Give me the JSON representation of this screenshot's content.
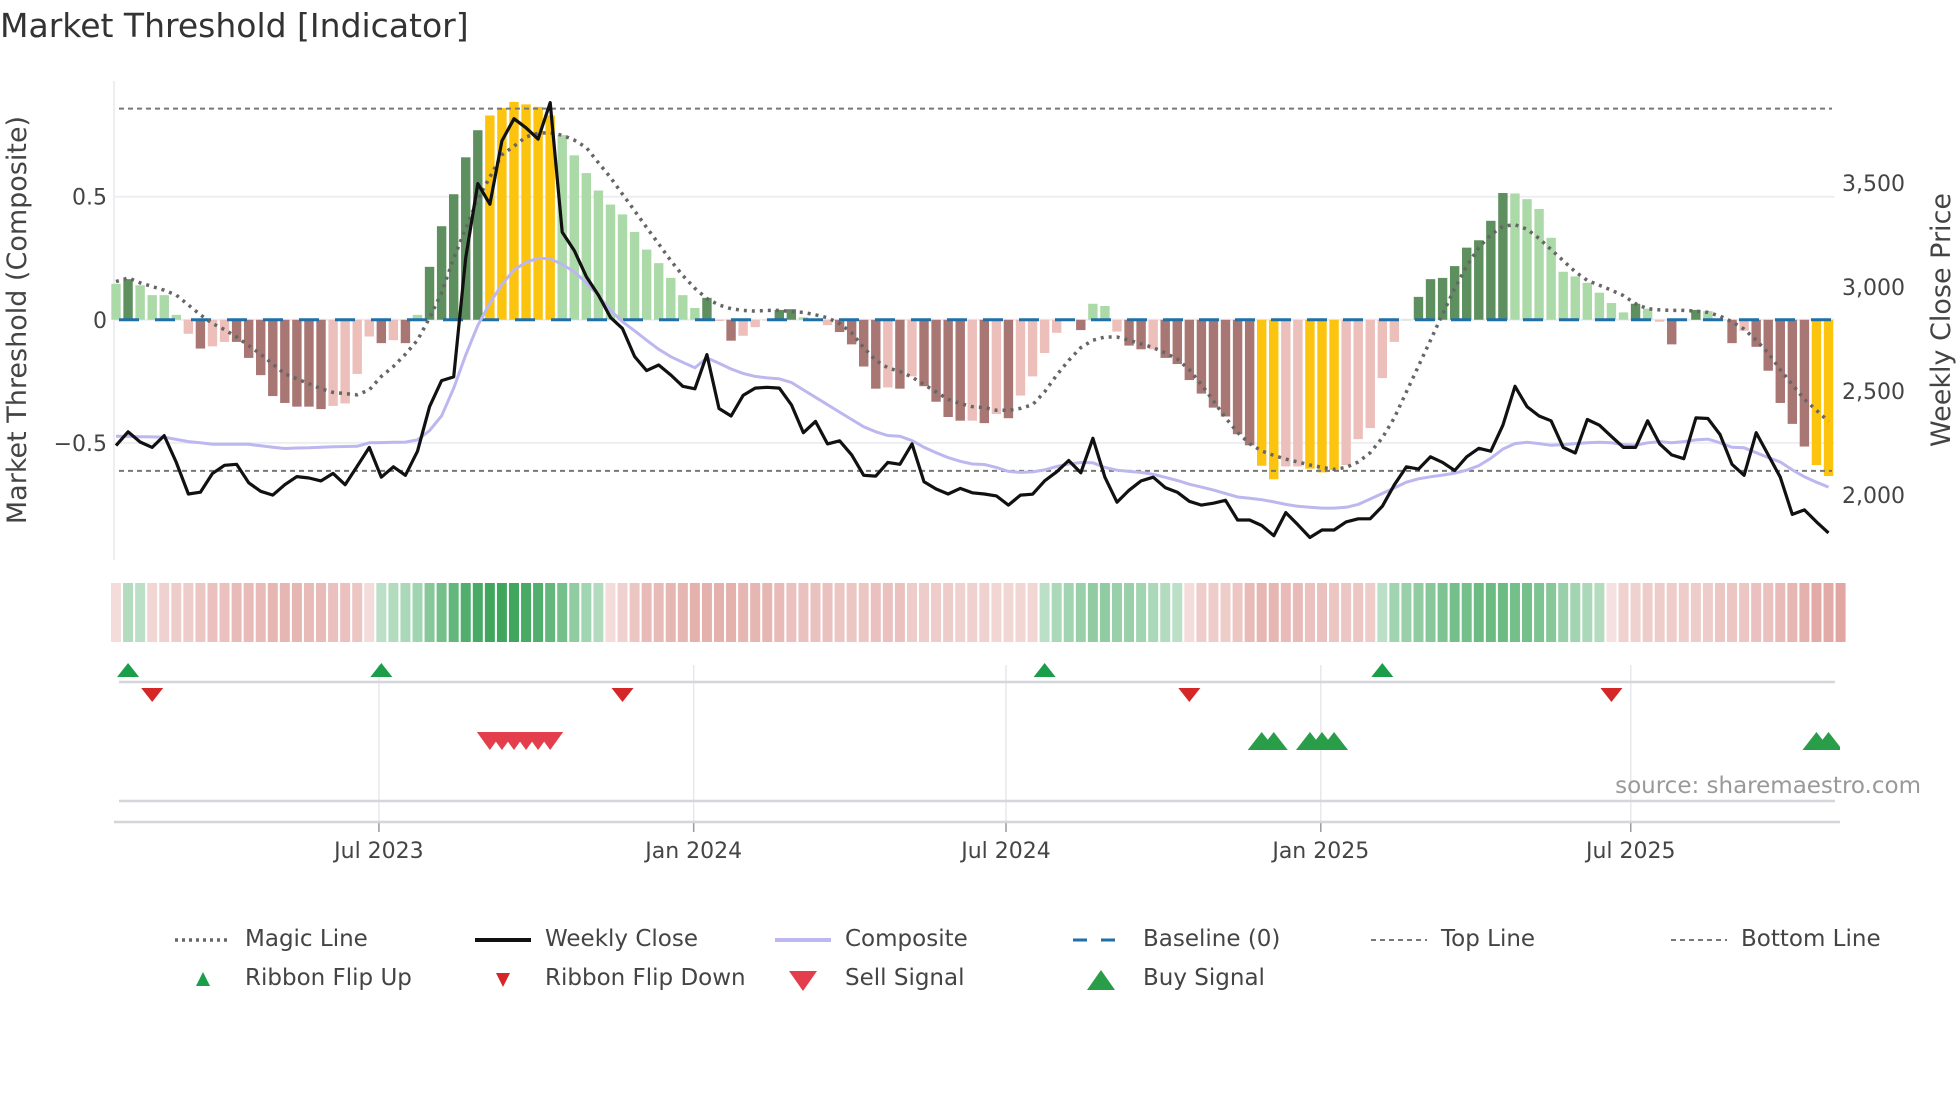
{
  "title": "Market Threshold [Indicator]",
  "source": "source: sharemaestro.com",
  "chart_data": {
    "type": "bar",
    "title": "Market Threshold [Indicator]",
    "ylabel_left": "Market Threshold (Composite)",
    "ylabel_right": "Weekly Close Price",
    "ylim_left": [
      -0.976,
      0.97
    ],
    "ylim_right": [
      1688,
      3990
    ],
    "left_ticks": [
      {
        "v": 0.5,
        "label": "0.5"
      },
      {
        "v": 0,
        "label": "0"
      },
      {
        "v": -0.5,
        "label": "−0.5"
      }
    ],
    "right_ticks": [
      {
        "v": 3500,
        "label": "3,500"
      },
      {
        "v": 3000,
        "label": "3,000"
      },
      {
        "v": 2500,
        "label": "2,500"
      },
      {
        "v": 2000,
        "label": "2,000"
      }
    ],
    "x_ticks": [
      {
        "week": 21.8,
        "label": "Jul 2023"
      },
      {
        "week": 47.9,
        "label": "Jan 2024"
      },
      {
        "week": 73.8,
        "label": "Jul 2024"
      },
      {
        "week": 99.9,
        "label": "Jan 2025"
      },
      {
        "week": 125.6,
        "label": "Jul 2025"
      }
    ],
    "top_line": 0.858,
    "bottom_line": -0.614,
    "baseline": 0,
    "colors": {
      "G": "#5e8f5e",
      "g": "#acd9a8",
      "R": "#a87673",
      "r": "#ecbfbb",
      "Y": "#fcc30f",
      "magic": "#666666",
      "close": "#111111",
      "composite": "#bcb7ef",
      "baseline": "#1f6fa8",
      "ref": "#777777",
      "flip_up": "#1a9e4a",
      "flip_down": "#d62728",
      "sell": "#e43d4b",
      "buy": "#2a9d48",
      "ribbon_pos": "#2e9e4f",
      "ribbon_neg": "#d4807a"
    },
    "composite_bars": [
      0.146,
      0.165,
      0.14,
      0.1,
      0.1,
      0.02,
      -0.057,
      -0.117,
      -0.108,
      -0.09,
      -0.09,
      -0.155,
      -0.225,
      -0.31,
      -0.338,
      -0.353,
      -0.353,
      -0.363,
      -0.35,
      -0.34,
      -0.22,
      -0.068,
      -0.095,
      -0.083,
      -0.095,
      0.02,
      0.215,
      0.38,
      0.51,
      0.66,
      0.77,
      0.83,
      0.86,
      0.885,
      0.875,
      0.865,
      0.83,
      0.75,
      0.668,
      0.596,
      0.525,
      0.468,
      0.428,
      0.357,
      0.285,
      0.23,
      0.17,
      0.1,
      0.048,
      0.089,
      -0.005,
      -0.085,
      -0.065,
      -0.03,
      0,
      0.04,
      0.043,
      0.01,
      0.005,
      -0.022,
      -0.05,
      -0.1,
      -0.19,
      -0.28,
      -0.275,
      -0.28,
      -0.23,
      -0.27,
      -0.333,
      -0.395,
      -0.41,
      -0.41,
      -0.42,
      -0.383,
      -0.4,
      -0.308,
      -0.23,
      -0.135,
      -0.053,
      0,
      -0.042,
      0.065,
      0.056,
      -0.048,
      -0.105,
      -0.12,
      -0.12,
      -0.155,
      -0.18,
      -0.245,
      -0.3,
      -0.357,
      -0.393,
      -0.465,
      -0.51,
      -0.593,
      -0.648,
      -0.596,
      -0.596,
      -0.605,
      -0.62,
      -0.61,
      -0.59,
      -0.485,
      -0.44,
      -0.237,
      -0.09,
      0,
      0.093,
      0.165,
      0.17,
      0.218,
      0.293,
      0.323,
      0.402,
      0.515,
      0.513,
      0.49,
      0.45,
      0.333,
      0.195,
      0.176,
      0.15,
      0.11,
      0.068,
      0.03,
      0.065,
      0.045,
      -0.008,
      -0.1,
      0,
      0.04,
      0.035,
      0,
      -0.095,
      -0.045,
      -0.11,
      -0.207,
      -0.338,
      -0.423,
      -0.515,
      -0.59,
      -0.635
    ],
    "bar_class": "gGggggrRrrRRRRRRRRrrrrRrRgGGGGGYYYYYYggggggggggggGrRrrrGGggrRRRRrRrRRRRrRrRrrrrrRggrRRrRRRRRRRRYYrrYYYrrrrrgGGGGGGGGggggggggggGgrRrGggRrRRRRRYY",
    "magic_line": [
      0.155,
      0.17,
      0.15,
      0.135,
      0.12,
      0.1,
      0.06,
      0.02,
      -0.015,
      -0.04,
      -0.07,
      -0.105,
      -0.14,
      -0.18,
      -0.22,
      -0.24,
      -0.26,
      -0.28,
      -0.295,
      -0.3,
      -0.305,
      -0.285,
      -0.23,
      -0.19,
      -0.14,
      -0.083,
      0.008,
      0.11,
      0.25,
      0.37,
      0.49,
      0.58,
      0.67,
      0.705,
      0.743,
      0.758,
      0.76,
      0.75,
      0.73,
      0.7,
      0.638,
      0.578,
      0.51,
      0.443,
      0.375,
      0.308,
      0.24,
      0.18,
      0.128,
      0.086,
      0.06,
      0.045,
      0.038,
      0.035,
      0.038,
      0.038,
      0.033,
      0.03,
      0.02,
      0.008,
      -0.015,
      -0.053,
      -0.113,
      -0.165,
      -0.195,
      -0.21,
      -0.233,
      -0.263,
      -0.293,
      -0.323,
      -0.34,
      -0.353,
      -0.357,
      -0.368,
      -0.368,
      -0.36,
      -0.345,
      -0.293,
      -0.225,
      -0.165,
      -0.113,
      -0.083,
      -0.07,
      -0.07,
      -0.083,
      -0.098,
      -0.113,
      -0.135,
      -0.16,
      -0.203,
      -0.263,
      -0.33,
      -0.398,
      -0.458,
      -0.503,
      -0.533,
      -0.551,
      -0.566,
      -0.578,
      -0.59,
      -0.6,
      -0.608,
      -0.6,
      -0.578,
      -0.54,
      -0.48,
      -0.398,
      -0.293,
      -0.188,
      -0.083,
      0.023,
      0.128,
      0.218,
      0.293,
      0.345,
      0.38,
      0.386,
      0.368,
      0.33,
      0.285,
      0.24,
      0.195,
      0.16,
      0.14,
      0.12,
      0.098,
      0.065,
      0.045,
      0.04,
      0.038,
      0.038,
      0.035,
      0.03,
      0.015,
      -0.008,
      -0.038,
      -0.083,
      -0.135,
      -0.203,
      -0.263,
      -0.323,
      -0.368,
      -0.413
    ],
    "composite_line": [
      -0.473,
      -0.474,
      -0.475,
      -0.476,
      -0.477,
      -0.486,
      -0.495,
      -0.5,
      -0.506,
      -0.506,
      -0.506,
      -0.506,
      -0.512,
      -0.518,
      -0.523,
      -0.521,
      -0.52,
      -0.518,
      -0.516,
      -0.515,
      -0.514,
      -0.5,
      -0.499,
      -0.498,
      -0.497,
      -0.488,
      -0.45,
      -0.39,
      -0.278,
      -0.143,
      -0.023,
      0.068,
      0.143,
      0.203,
      0.233,
      0.25,
      0.248,
      0.225,
      0.195,
      0.15,
      0.098,
      0.038,
      -0.008,
      -0.045,
      -0.083,
      -0.12,
      -0.15,
      -0.173,
      -0.195,
      -0.155,
      -0.177,
      -0.2,
      -0.218,
      -0.23,
      -0.236,
      -0.24,
      -0.255,
      -0.285,
      -0.315,
      -0.345,
      -0.375,
      -0.405,
      -0.435,
      -0.455,
      -0.47,
      -0.473,
      -0.491,
      -0.518,
      -0.54,
      -0.56,
      -0.575,
      -0.586,
      -0.588,
      -0.6,
      -0.616,
      -0.62,
      -0.618,
      -0.61,
      -0.596,
      -0.586,
      -0.58,
      -0.581,
      -0.6,
      -0.611,
      -0.616,
      -0.62,
      -0.628,
      -0.64,
      -0.653,
      -0.668,
      -0.68,
      -0.692,
      -0.706,
      -0.72,
      -0.725,
      -0.731,
      -0.74,
      -0.75,
      -0.758,
      -0.762,
      -0.765,
      -0.765,
      -0.762,
      -0.75,
      -0.728,
      -0.706,
      -0.683,
      -0.66,
      -0.646,
      -0.638,
      -0.631,
      -0.623,
      -0.611,
      -0.593,
      -0.563,
      -0.525,
      -0.503,
      -0.498,
      -0.503,
      -0.51,
      -0.507,
      -0.503,
      -0.5,
      -0.498,
      -0.5,
      -0.507,
      -0.51,
      -0.5,
      -0.495,
      -0.5,
      -0.495,
      -0.488,
      -0.485,
      -0.5,
      -0.518,
      -0.52,
      -0.54,
      -0.56,
      -0.578,
      -0.61,
      -0.638,
      -0.66,
      -0.68
    ],
    "weekly_close": [
      2238,
      2304,
      2255,
      2229,
      2286,
      2157,
      2005,
      2014,
      2104,
      2143,
      2148,
      2059,
      2018,
      2000,
      2050,
      2089,
      2082,
      2068,
      2104,
      2050,
      2139,
      2229,
      2086,
      2136,
      2095,
      2211,
      2425,
      2550,
      2568,
      3140,
      3497,
      3398,
      3702,
      3809,
      3765,
      3711,
      3886,
      3264,
      3175,
      3050,
      2961,
      2854,
      2800,
      2666,
      2598,
      2625,
      2577,
      2523,
      2511,
      2675,
      2416,
      2380,
      2479,
      2514,
      2518,
      2514,
      2434,
      2300,
      2354,
      2246,
      2261,
      2193,
      2095,
      2091,
      2157,
      2148,
      2246,
      2064,
      2029,
      2005,
      2032,
      2011,
      2005,
      1996,
      1952,
      2000,
      2004,
      2068,
      2112,
      2166,
      2107,
      2273,
      2086,
      1966,
      2023,
      2068,
      2086,
      2036,
      2014,
      1970,
      1952,
      1961,
      1975,
      1880,
      1880,
      1854,
      1805,
      1916,
      1857,
      1796,
      1832,
      1832,
      1871,
      1886,
      1886,
      1946,
      2050,
      2136,
      2125,
      2184,
      2157,
      2118,
      2184,
      2225,
      2211,
      2336,
      2523,
      2425,
      2380,
      2357,
      2229,
      2202,
      2363,
      2336,
      2282,
      2229,
      2229,
      2357,
      2246,
      2193,
      2175,
      2371,
      2368,
      2291,
      2148,
      2095,
      2300,
      2193,
      2086,
      1907,
      1929,
      1871,
      1818
    ],
    "ribbon": [
      -0.15,
      0.25,
      0.2,
      -0.2,
      -0.25,
      -0.3,
      -0.3,
      -0.35,
      -0.4,
      -0.4,
      -0.45,
      -0.45,
      -0.45,
      -0.5,
      -0.5,
      -0.5,
      -0.45,
      -0.45,
      -0.4,
      -0.4,
      -0.35,
      -0.15,
      0.2,
      0.25,
      0.3,
      0.35,
      0.5,
      0.6,
      0.7,
      0.8,
      0.85,
      0.9,
      0.9,
      0.9,
      0.85,
      0.8,
      0.7,
      0.6,
      0.45,
      0.35,
      0.25,
      -0.15,
      -0.25,
      -0.35,
      -0.45,
      -0.45,
      -0.5,
      -0.5,
      -0.55,
      -0.55,
      -0.55,
      -0.55,
      -0.5,
      -0.5,
      -0.5,
      -0.45,
      -0.4,
      -0.4,
      -0.4,
      -0.4,
      -0.35,
      -0.35,
      -0.35,
      -0.4,
      -0.4,
      -0.4,
      -0.3,
      -0.3,
      -0.3,
      -0.3,
      -0.25,
      -0.25,
      -0.25,
      -0.2,
      -0.2,
      -0.2,
      -0.2,
      0.2,
      0.3,
      0.35,
      0.4,
      0.45,
      0.45,
      0.4,
      0.4,
      0.35,
      0.3,
      0.25,
      0.2,
      -0.15,
      -0.3,
      -0.3,
      -0.3,
      -0.35,
      -0.45,
      -0.5,
      -0.5,
      -0.45,
      -0.45,
      -0.4,
      -0.4,
      -0.35,
      -0.35,
      -0.35,
      -0.3,
      0.2,
      0.35,
      0.4,
      0.45,
      0.5,
      0.55,
      0.6,
      0.6,
      0.65,
      0.65,
      0.65,
      0.6,
      0.6,
      0.55,
      0.5,
      0.4,
      0.35,
      0.3,
      0.25,
      -0.1,
      -0.25,
      -0.25,
      -0.3,
      -0.3,
      -0.3,
      -0.3,
      -0.3,
      -0.3,
      -0.35,
      -0.35,
      -0.35,
      -0.4,
      -0.4,
      -0.45,
      -0.5,
      -0.55,
      -0.6,
      -0.6,
      -0.65
    ],
    "ribbon_flip_up": [
      1,
      22,
      77,
      105
    ],
    "ribbon_flip_down": [
      3,
      42,
      89,
      124
    ],
    "sell_signals": [
      31,
      32,
      33,
      34,
      35,
      36
    ],
    "buy_signals": [
      95,
      96,
      99,
      100,
      101,
      141,
      142
    ],
    "legend": {
      "row1": [
        {
          "key": "magic",
          "label": "Magic Line"
        },
        {
          "key": "close",
          "label": "Weekly Close"
        },
        {
          "key": "composite",
          "label": "Composite"
        },
        {
          "key": "baseline",
          "label": "Baseline (0)"
        },
        {
          "key": "top",
          "label": "Top Line"
        },
        {
          "key": "bottom",
          "label": "Bottom Line"
        }
      ],
      "row2": [
        {
          "key": "flip_up",
          "label": "Ribbon Flip Up"
        },
        {
          "key": "flip_down",
          "label": "Ribbon Flip Down"
        },
        {
          "key": "sell",
          "label": "Sell Signal"
        },
        {
          "key": "buy",
          "label": "Buy Signal"
        }
      ]
    },
    "legend_position": "bottom"
  }
}
